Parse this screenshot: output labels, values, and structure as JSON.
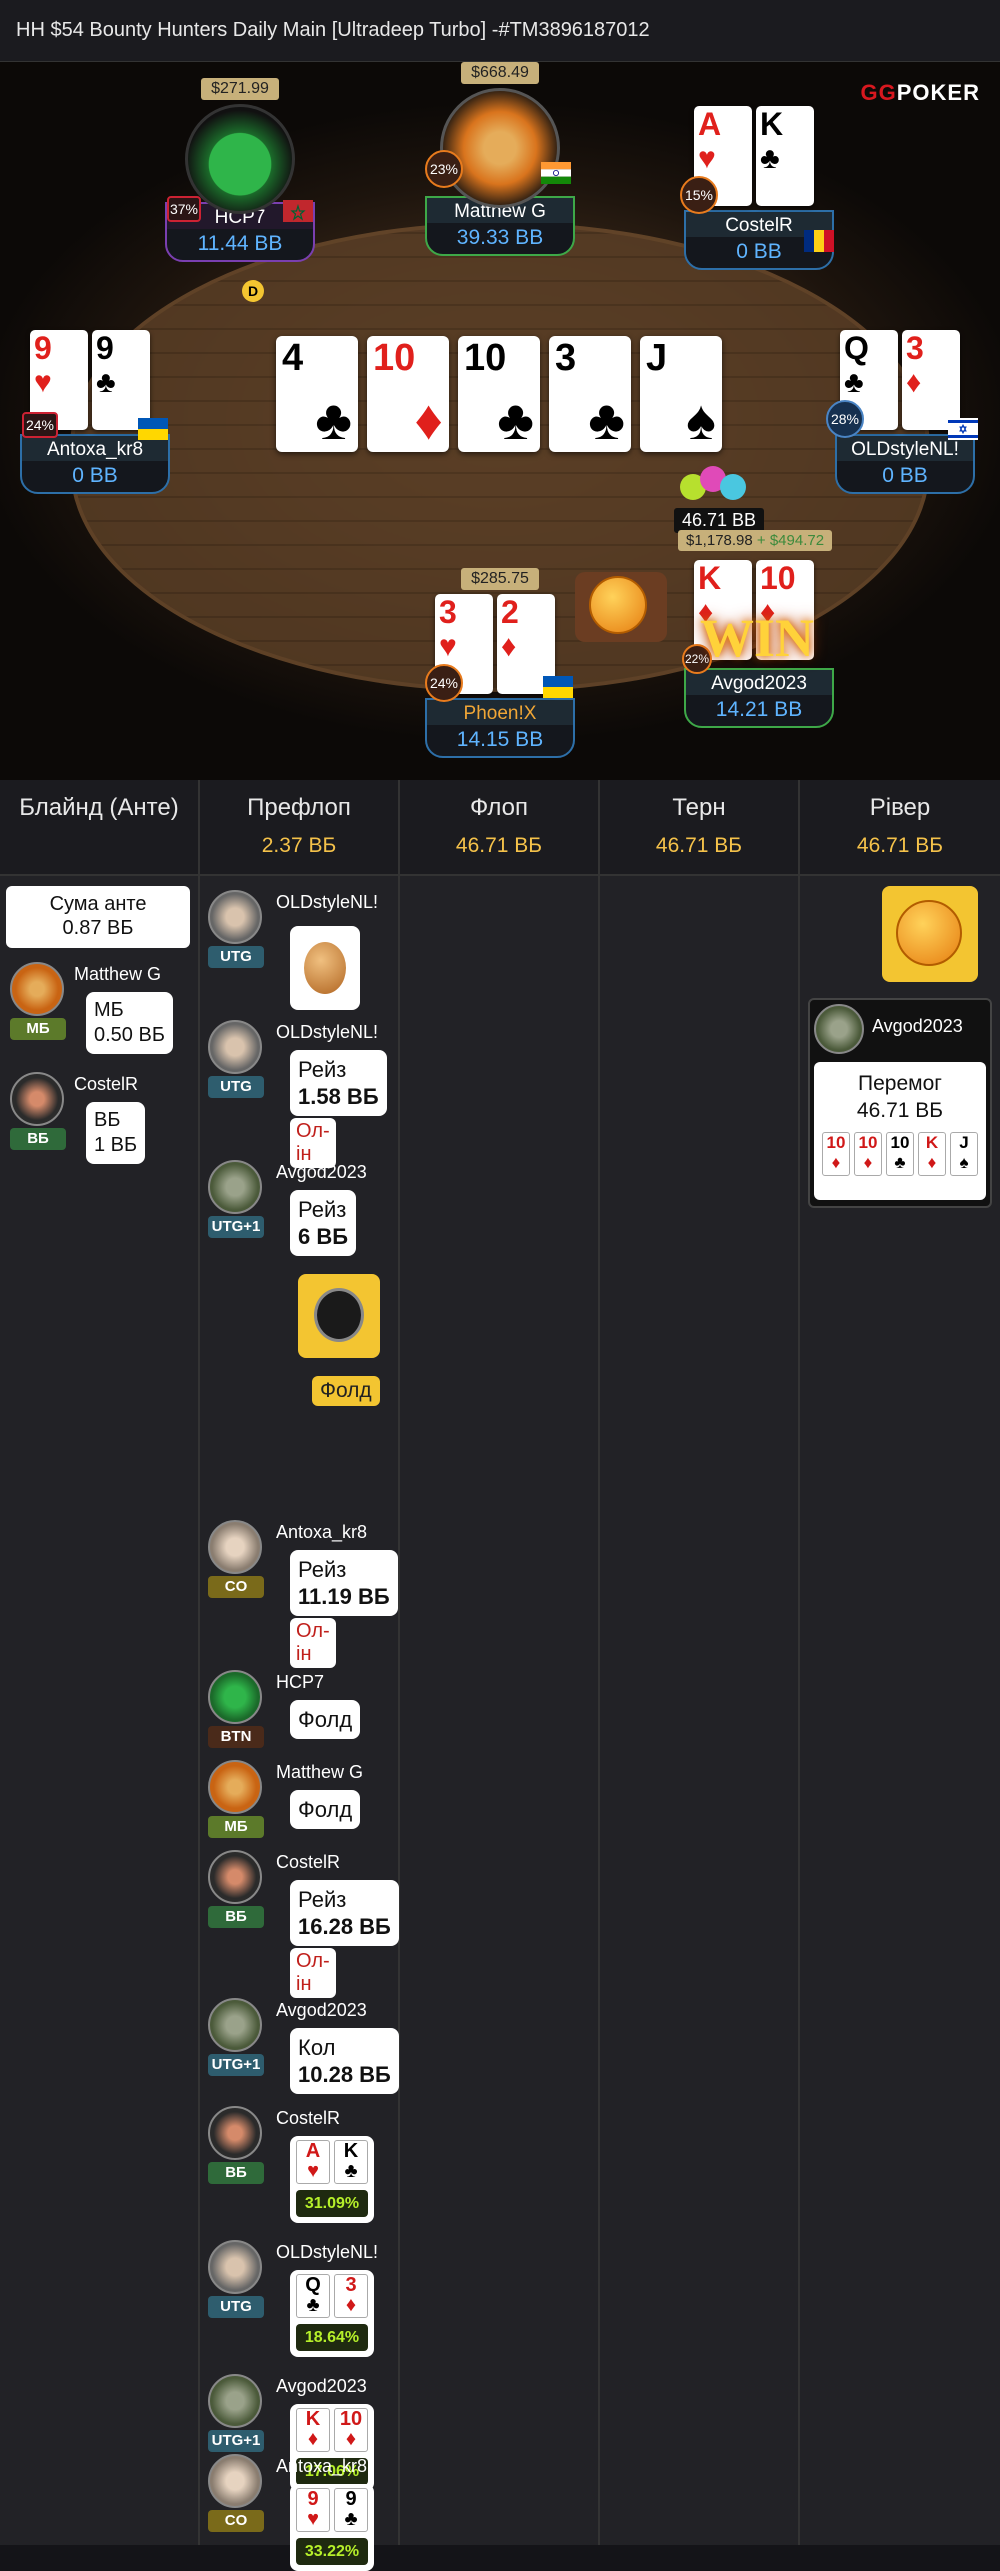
{
  "window": {
    "title": "HH $54 Bounty Hunters Daily Main [Ultradeep Turbo] -#TM3896187012"
  },
  "logo": {
    "text": "GG",
    "text2": "POKER"
  },
  "table": {
    "board": [
      {
        "rank": "4",
        "suit": "♣",
        "color": "black"
      },
      {
        "rank": "10",
        "suit": "♦",
        "color": "red"
      },
      {
        "rank": "10",
        "suit": "♣",
        "color": "black"
      },
      {
        "rank": "3",
        "suit": "♣",
        "color": "black"
      },
      {
        "rank": "J",
        "suit": "♠",
        "color": "black"
      }
    ],
    "players": {
      "hcp7": {
        "name": "HCP7",
        "stack": "11.44 BB",
        "bounty": "$271.99",
        "pct": "37%"
      },
      "matthew": {
        "name": "Matthew G",
        "stack": "39.33 BB",
        "bounty": "$668.49",
        "pct": "23%"
      },
      "costel": {
        "name": "CostelR",
        "stack": "0 BB",
        "pct": "15%",
        "cards": [
          {
            "rank": "A",
            "suit": "♥"
          },
          {
            "rank": "K",
            "suit": "♣"
          }
        ]
      },
      "antoxa": {
        "name": "Antoxa_kr8",
        "stack": "0 BB",
        "pct": "24%",
        "cards": [
          {
            "rank": "9",
            "suit": "♥"
          },
          {
            "rank": "9",
            "suit": "♣"
          }
        ]
      },
      "oldstyle": {
        "name": "OLDstyleNL!",
        "stack": "0 BB",
        "pct": "28%",
        "cards": [
          {
            "rank": "Q",
            "suit": "♣"
          },
          {
            "rank": "3",
            "suit": "♦"
          }
        ]
      },
      "phoenix": {
        "name": "Phoen!X",
        "stack": "14.15 BB",
        "bounty": "$285.75",
        "pct": "24%",
        "cards": [
          {
            "rank": "3",
            "suit": "♥"
          },
          {
            "rank": "2",
            "suit": "♦"
          }
        ]
      },
      "avgod": {
        "name": "Avgod2023",
        "stack": "14.21 BB",
        "pct": "22%",
        "cards": [
          {
            "rank": "K",
            "suit": "♦"
          },
          {
            "rank": "10",
            "suit": "♦"
          }
        ]
      }
    },
    "dealer": "D",
    "pot": "46.71 BB",
    "win_amount": "$1,178.98",
    "win_bonus": "+ $494.72",
    "win_text": "WIN"
  },
  "log": {
    "columns": [
      {
        "title": "Блайнд (Анте)",
        "value": ""
      },
      {
        "title": "Префлоп",
        "value": "2.37 ВБ"
      },
      {
        "title": "Флоп",
        "value": "46.71 ВБ"
      },
      {
        "title": "Терн",
        "value": "46.71 ВБ"
      },
      {
        "title": "Рівер",
        "value": "46.71 ВБ"
      }
    ],
    "blind": {
      "ante_label": "Сума анте",
      "ante_value": "0.87 ВБ",
      "events": [
        {
          "name": "Matthew G",
          "pos": "МБ",
          "l1": "МБ",
          "l2": "0.50 ВБ"
        },
        {
          "name": "CostelR",
          "pos": "ВБ",
          "l1": "ВБ",
          "l2": "1 ВБ"
        }
      ]
    },
    "preflop": [
      {
        "name": "OLDstyleNL!",
        "pos": "UTG",
        "type": "emote"
      },
      {
        "name": "OLDstyleNL!",
        "pos": "UTG",
        "l1": "Рейз",
        "l2": "1.58 ВБ",
        "allin": "Ол-ін"
      },
      {
        "name": "Avgod2023",
        "pos": "UTG+1",
        "l1": "Рейз",
        "l2": "6 ВБ"
      },
      {
        "type": "timer",
        "fold": "Фолд"
      },
      {
        "name": "Antoxa_kr8",
        "pos": "CO",
        "l1": "Рейз",
        "l2": "11.19 ВБ",
        "allin": "Ол-ін"
      },
      {
        "name": "HCP7",
        "pos": "BTN",
        "l1": "Фолд"
      },
      {
        "name": "Matthew G",
        "pos": "МБ",
        "l1": "Фолд"
      },
      {
        "name": "CostelR",
        "pos": "ВБ",
        "l1": "Рейз",
        "l2": "16.28 ВБ",
        "allin": "Ол-ін"
      },
      {
        "name": "Avgod2023",
        "pos": "UTG+1",
        "l1": "Кол",
        "l2": "10.28 ВБ"
      },
      {
        "name": "CostelR",
        "pos": "ВБ",
        "cards": [
          {
            "rank": "A",
            "suit": "♥"
          },
          {
            "rank": "K",
            "suit": "♣"
          }
        ],
        "eq": "31.09%"
      },
      {
        "name": "OLDstyleNL!",
        "pos": "UTG",
        "cards": [
          {
            "rank": "Q",
            "suit": "♣"
          },
          {
            "rank": "3",
            "suit": "♦"
          }
        ],
        "eq": "18.64%"
      },
      {
        "name": "Avgod2023",
        "pos": "UTG+1",
        "cards": [
          {
            "rank": "K",
            "suit": "♦"
          },
          {
            "rank": "10",
            "suit": "♦"
          }
        ],
        "eq": "17.06%"
      },
      {
        "name": "Antoxa_kr8",
        "pos": "CO",
        "cards": [
          {
            "rank": "9",
            "suit": "♥"
          },
          {
            "rank": "9",
            "suit": "♣"
          }
        ],
        "eq": "33.22%"
      }
    ],
    "river": {
      "winner": "Avgod2023",
      "won_label": "Перемог",
      "won_value": "46.71 ВБ",
      "cards": [
        {
          "rank": "10",
          "suit": "♦"
        },
        {
          "rank": "10",
          "suit": "♦"
        },
        {
          "rank": "10",
          "suit": "♣"
        },
        {
          "rank": "K",
          "suit": "♦"
        },
        {
          "rank": "J",
          "suit": "♠"
        }
      ]
    }
  },
  "colors": {
    "stack_blue": "#5fb4ff",
    "pot_gold": "#f5c24a",
    "win_gold": "#ffd23a",
    "allin_red": "#c0201c",
    "equity_green": "#b6f02a"
  }
}
